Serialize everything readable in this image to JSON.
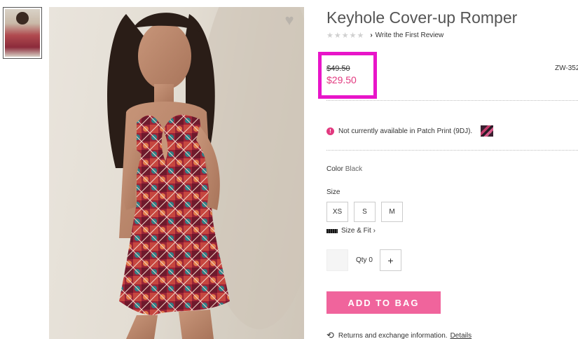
{
  "product": {
    "title": "Keyhole Cover-up Romper",
    "rating_stars": "★★★★★",
    "review_link": "Write the First Review",
    "original_price": "$49.50",
    "sale_price": "$29.50",
    "sku": "ZW-352",
    "availability": "Not currently available in Patch Print (9DJ).",
    "color_label": "Color",
    "color_value": "Black",
    "size_label": "Size",
    "sizes": [
      "XS",
      "S",
      "M"
    ],
    "size_fit_link": "Size & Fit",
    "qty_label": "Qty 0",
    "add_to_bag": "ADD TO BAG",
    "returns_text": "Returns and exchange information.",
    "details_link": "Details"
  },
  "icons": {
    "heart": "heart-icon",
    "alert": "alert-icon",
    "ruler": "ruler-icon",
    "returns": "returns-icon"
  },
  "colors": {
    "sale_price": "#e2397f",
    "add_to_bag_bg": "#f0649c",
    "highlight_box": "#e815c9"
  }
}
